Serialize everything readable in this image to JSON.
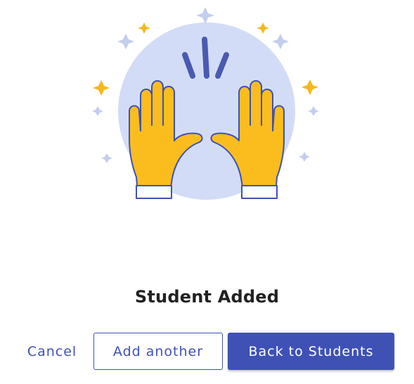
{
  "illustration": {
    "icon": "raising-hands-icon",
    "colors": {
      "circle": "#d3dcf6",
      "hands": "#fbbd1e",
      "outline": "#3f51b5",
      "sparkle_gold": "#f6b81c",
      "sparkle_light": "#c3cdee",
      "rays": "#4a5ab0"
    }
  },
  "title": "Student Added",
  "actions": {
    "cancel_label": "Cancel",
    "add_another_label": "Add another",
    "back_label": "Back to Students"
  },
  "colors": {
    "accent": "#3f51b5",
    "text": "#212121",
    "background": "#ffffff"
  }
}
